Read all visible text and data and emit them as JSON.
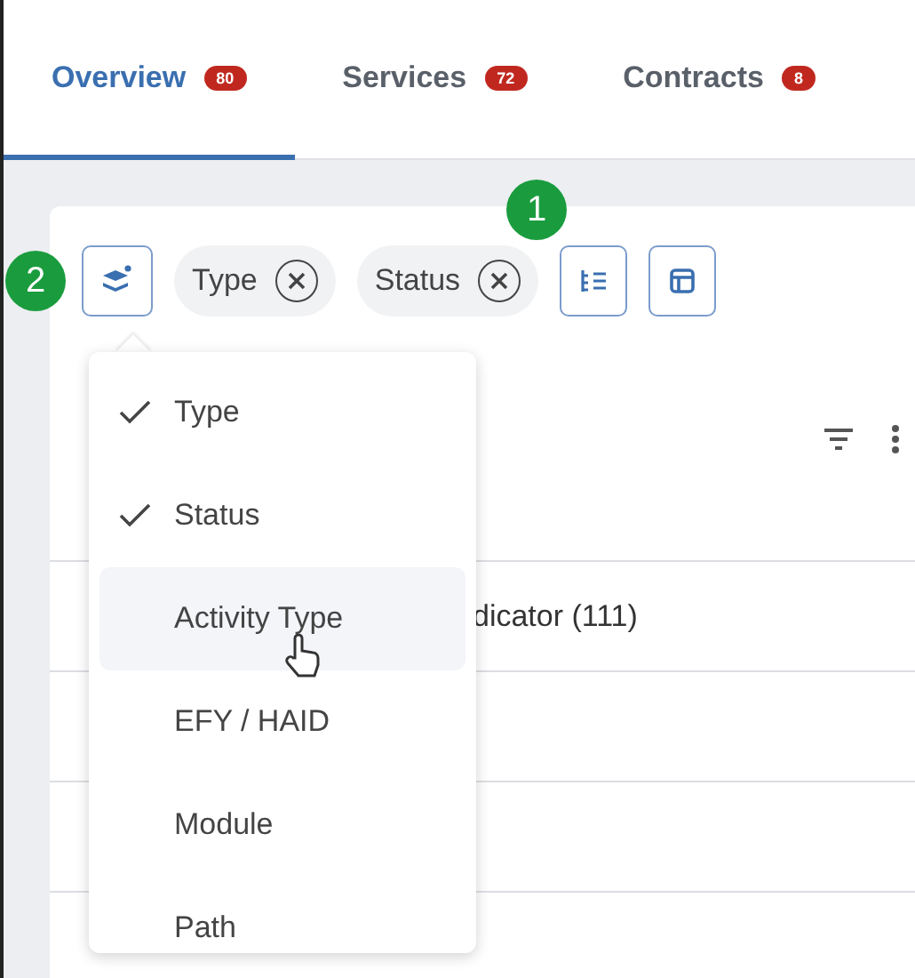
{
  "tabs": [
    {
      "label": "Overview",
      "count": "80",
      "selected": true
    },
    {
      "label": "Services",
      "count": "72",
      "selected": false
    },
    {
      "label": "Contracts",
      "count": "8",
      "selected": false
    }
  ],
  "toolbar": {
    "chips": [
      "Type",
      "Status"
    ]
  },
  "callouts": [
    {
      "label": "1"
    },
    {
      "label": "2"
    }
  ],
  "menu": {
    "items": [
      {
        "label": "Type",
        "checked": true,
        "highlighted": false
      },
      {
        "label": "Status",
        "checked": true,
        "highlighted": false
      },
      {
        "label": "Activity Type",
        "checked": false,
        "highlighted": true
      },
      {
        "label": "EFY / HAID",
        "checked": false,
        "highlighted": false
      },
      {
        "label": "Module",
        "checked": false,
        "highlighted": false
      },
      {
        "label": "Path",
        "checked": false,
        "highlighted": false
      }
    ]
  },
  "table": {
    "rows": [
      {
        "cell": "dicator (111)"
      },
      {},
      {}
    ]
  }
}
